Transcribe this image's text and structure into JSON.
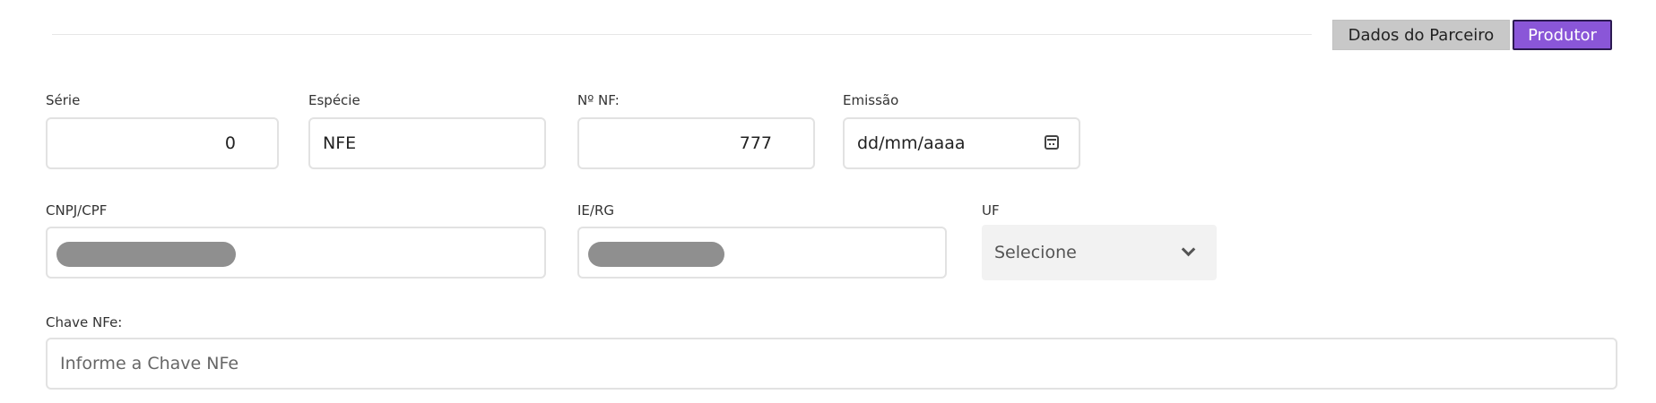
{
  "header": {
    "buttons": {
      "partner_label": "Dados do Parceiro",
      "producer_label": "Produtor"
    }
  },
  "form": {
    "serie": {
      "label": "Série",
      "value": "0"
    },
    "especie": {
      "label": "Espécie",
      "value": "NFE"
    },
    "nf": {
      "label": "Nº NF:",
      "value": "777"
    },
    "emissao": {
      "label": "Emissão",
      "value": "dd/mm/aaaa"
    },
    "cnpj": {
      "label": "CNPJ/CPF",
      "value": ""
    },
    "ie": {
      "label": "IE/RG",
      "value": ""
    },
    "uf": {
      "label": "UF",
      "selected": "Selecione"
    },
    "chave": {
      "label": "Chave NFe:",
      "placeholder": "Informe a Chave NFe"
    }
  },
  "colors": {
    "accent": "#8a56d8",
    "secondary_button": "#c8c8c8",
    "border": "#e2e2e2"
  }
}
